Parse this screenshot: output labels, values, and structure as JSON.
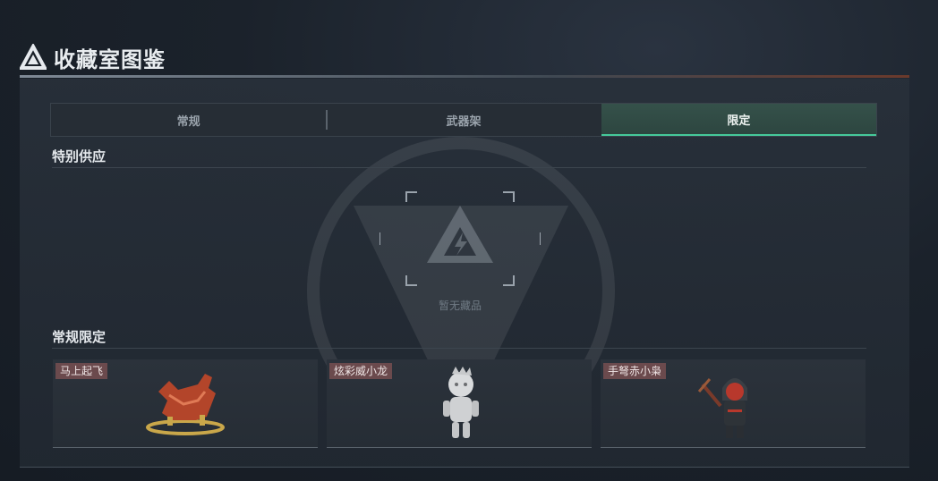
{
  "header": {
    "title": "收藏室图鉴",
    "logo_icon": "alpha-triangle-logo"
  },
  "tabs": [
    {
      "label": "常规",
      "active": false
    },
    {
      "label": "武器架",
      "active": false
    },
    {
      "label": "限定",
      "active": true
    }
  ],
  "sections": {
    "special": {
      "title": "特别供应",
      "empty_text": "暂无藏品",
      "empty_icon": "alpha-triangle-logo"
    },
    "limited": {
      "title": "常规限定",
      "items": [
        {
          "name": "马上起飞",
          "icon": "rocking-horse-icon"
        },
        {
          "name": "炫彩威小龙",
          "icon": "dragon-figure-icon"
        },
        {
          "name": "手弩赤小枭",
          "icon": "hooded-crossbow-figure-icon"
        }
      ]
    }
  },
  "colors": {
    "accent": "#46c99a",
    "tag_bg": "#6b4a4d",
    "background": "#1b222b"
  }
}
